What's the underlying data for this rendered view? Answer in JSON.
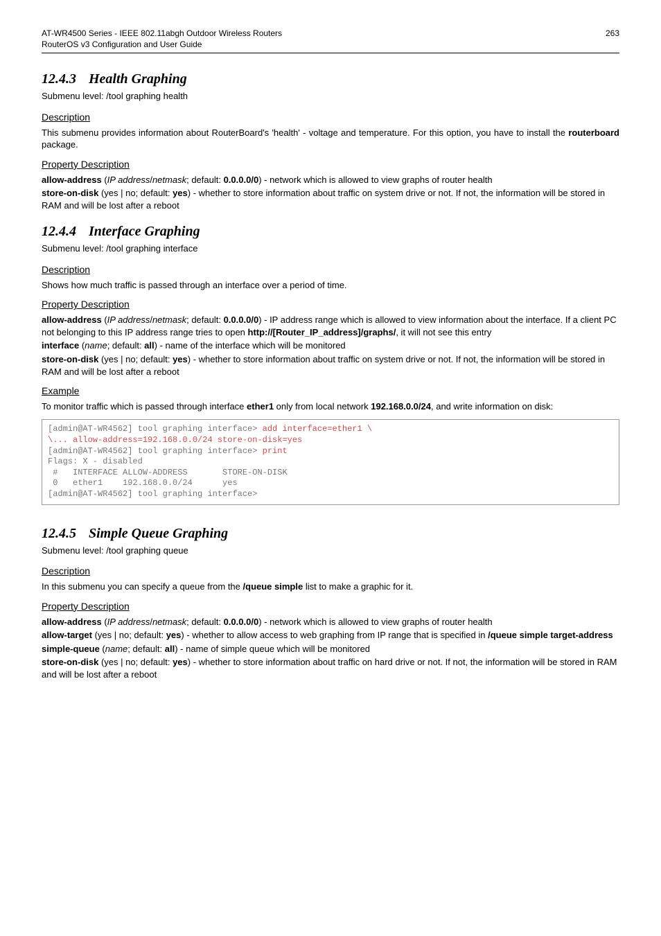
{
  "page": {
    "header_left": "AT-WR4500 Series - IEEE 802.11abgh Outdoor Wireless Routers\nRouterOS v3 Configuration and User Guide",
    "header_right": "263"
  },
  "s1": {
    "num": "12.4.3",
    "title": "Health Graphing",
    "submenu": "Submenu level: /tool graphing health",
    "desc_h": "Description",
    "desc_t1": "This submenu provides information about RouterBoard's 'health' - voltage and temperature. For this option, you have to install the ",
    "desc_b": "routerboard",
    "desc_t2": " package.",
    "prop_h": "Property Description",
    "p1_a": "allow-address",
    "p1_b": " (",
    "p1_c": "IP address",
    "p1_d": "/",
    "p1_e": "netmask",
    "p1_f": "; default: ",
    "p1_g": "0.0.0.0/0",
    "p1_h": ") - network which is allowed to view graphs of router health",
    "p2_a": "store-on-disk",
    "p2_b": " (yes | no; default: ",
    "p2_c": "yes",
    "p2_d": ") - whether to store information about traffic on system drive or not. If not, the information will be stored in RAM and will be lost after a reboot"
  },
  "s2": {
    "num": "12.4.4",
    "title": "Interface Graphing",
    "submenu": "Submenu level: /tool graphing interface",
    "desc_h": "Description",
    "desc_t": "Shows how much traffic is passed through an interface over a period of time.",
    "prop_h": "Property Description",
    "p1_a": "allow-address",
    "p1_b": " (",
    "p1_c": "IP address",
    "p1_d": "/",
    "p1_e": "netmask",
    "p1_f": "; default: ",
    "p1_g": "0.0.0.0/0",
    "p1_h": ") - IP address range which is allowed to view information about the interface. If a client PC not belonging to this IP address range tries to open ",
    "p1_i": "http://[Router_IP_address]/graphs/",
    "p1_j": ", it will not see this entry",
    "p2_a": "interface",
    "p2_b": " (",
    "p2_c": "name",
    "p2_d": "; default: ",
    "p2_e": "all",
    "p2_f": ") - name of the interface which will be monitored",
    "p3_a": "store-on-disk",
    "p3_b": " (yes | no; default: ",
    "p3_c": "yes",
    "p3_d": ") - whether to store information about traffic on system drive or not. If not, the information will be stored in RAM and will be lost after a reboot",
    "ex_h": "Example",
    "ex_t1": "To monitor traffic which is passed through interface ",
    "ex_b1": "ether1",
    "ex_t2": " only from local network ",
    "ex_b2": "192.168.0.0/24",
    "ex_t3": ", and write information on disk:",
    "code_l1a": "[admin@AT-WR4562] tool graphing interface> ",
    "code_l1b": "add interface=ether1 \\",
    "code_l2": "\\... allow-address=192.168.0.0/24 store-on-disk=yes",
    "code_l3a": "[admin@AT-WR4562] tool graphing interface>",
    "code_l3b": " print",
    "code_l4": "Flags: X - disabled",
    "code_l5": " #   INTERFACE ALLOW-ADDRESS       STORE-ON-DISK",
    "code_l6": " 0   ether1    192.168.0.0/24      yes",
    "code_l7": "[admin@AT-WR4562] tool graphing interface>"
  },
  "s3": {
    "num": "12.4.5",
    "title": "Simple Queue Graphing",
    "submenu": "Submenu level: /tool graphing queue",
    "desc_h": "Description",
    "desc_t1": "In this submenu you can specify a queue from the ",
    "desc_b": "/queue simple",
    "desc_t2": " list to make a graphic for it.",
    "prop_h": "Property Description",
    "p1_a": "allow-address",
    "p1_b": " (",
    "p1_c": "IP address",
    "p1_d": "/",
    "p1_e": "netmask",
    "p1_f": "; default: ",
    "p1_g": "0.0.0.0/0",
    "p1_h": ") - network which is allowed to view graphs of router health",
    "p2_a": "allow-target",
    "p2_b": " (yes | no; default: ",
    "p2_c": "yes",
    "p2_d": ") - whether to allow access to web graphing from IP range that is specified in ",
    "p2_e": "/queue simple target-address",
    "p3_a": "simple-queue",
    "p3_b": " (",
    "p3_c": "name",
    "p3_d": "; default: ",
    "p3_e": "all",
    "p3_f": ") - name of simple queue which will be monitored",
    "p4_a": "store-on-disk",
    "p4_b": " (yes | no; default: ",
    "p4_c": "yes",
    "p4_d": ") - whether to store information about traffic on hard drive or not. If not, the information will be stored in RAM and will be lost after a reboot"
  }
}
